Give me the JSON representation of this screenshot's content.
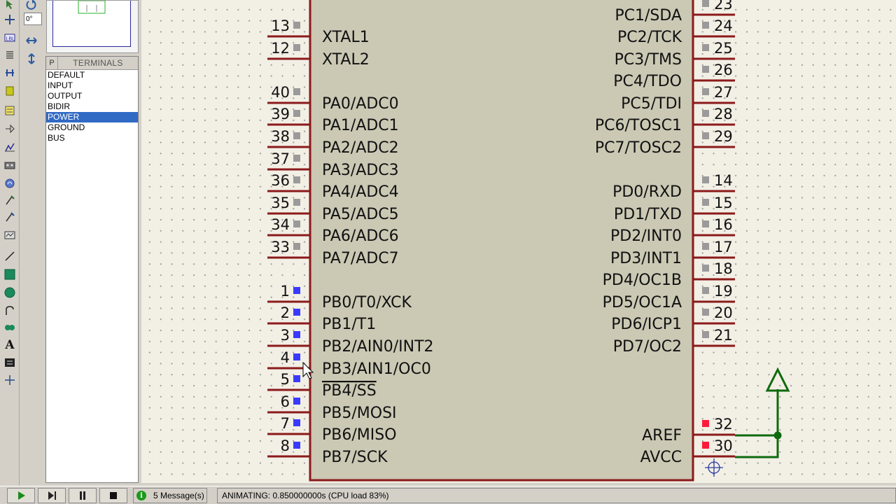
{
  "toolbar": {
    "tools": [
      "undo-icon",
      "component-icon",
      "label-icon",
      "text-script-icon",
      "bus-icon",
      "subcircuit-icon",
      "terminal-icon",
      "pin-icon",
      "graph-icon",
      "tape-icon",
      "generator-icon",
      "probe-icon",
      "current-probe-icon",
      "virtual-instrument-icon",
      "line-icon",
      "box-icon",
      "circle-icon",
      "arc-icon",
      "path-icon",
      "text-icon",
      "symbol-icon",
      "marker-icon"
    ]
  },
  "rotation": {
    "angle_value": "0°"
  },
  "terminals": {
    "p_label": "P",
    "title": "TERMINALS",
    "items": [
      "DEFAULT",
      "INPUT",
      "OUTPUT",
      "BIDIR",
      "POWER",
      "GROUND",
      "BUS"
    ],
    "selected_index": 4
  },
  "schematic": {
    "colors": {
      "body_fill": "#cbc8b4",
      "body_border": "#8b1a1a",
      "pin_line": "#8b1a1a",
      "wire": "#0e6a0e",
      "pin_low": "#3a3aff",
      "pin_high": "#ff1a3c",
      "pin_idle": "#9a9a9a"
    },
    "left_pins": [
      {
        "num": "13",
        "label": "XTAL1",
        "state": "idle"
      },
      {
        "num": "12",
        "label": "XTAL2",
        "state": "idle"
      },
      {
        "num": "40",
        "label": "PA0/ADC0",
        "state": "idle"
      },
      {
        "num": "39",
        "label": "PA1/ADC1",
        "state": "idle"
      },
      {
        "num": "38",
        "label": "PA2/ADC2",
        "state": "idle"
      },
      {
        "num": "37",
        "label": "PA3/ADC3",
        "state": "idle"
      },
      {
        "num": "36",
        "label": "PA4/ADC4",
        "state": "idle"
      },
      {
        "num": "35",
        "label": "PA5/ADC5",
        "state": "idle"
      },
      {
        "num": "34",
        "label": "PA6/ADC6",
        "state": "idle"
      },
      {
        "num": "33",
        "label": "PA7/ADC7",
        "state": "idle"
      },
      {
        "num": "1",
        "label": "PB0/T0/XCK",
        "state": "low"
      },
      {
        "num": "2",
        "label": "PB1/T1",
        "state": "low"
      },
      {
        "num": "3",
        "label": "PB2/AIN0/INT2",
        "state": "low"
      },
      {
        "num": "4",
        "label": "PB3/AIN1/OC0",
        "state": "low"
      },
      {
        "num": "5",
        "label": "PB4/SS",
        "state": "low"
      },
      {
        "num": "6",
        "label": "PB5/MOSI",
        "state": "low"
      },
      {
        "num": "7",
        "label": "PB6/MISO",
        "state": "low"
      },
      {
        "num": "8",
        "label": "PB7/SCK",
        "state": "low"
      }
    ],
    "right_pins": [
      {
        "num": "23",
        "label": "PC1/SDA",
        "state": "idle"
      },
      {
        "num": "24",
        "label": "PC2/TCK",
        "state": "idle"
      },
      {
        "num": "25",
        "label": "PC3/TMS",
        "state": "idle"
      },
      {
        "num": "26",
        "label": "PC4/TDO",
        "state": "idle"
      },
      {
        "num": "27",
        "label": "PC5/TDI",
        "state": "idle"
      },
      {
        "num": "28",
        "label": "PC6/TOSC1",
        "state": "idle"
      },
      {
        "num": "29",
        "label": "PC7/TOSC2",
        "state": "idle"
      },
      {
        "num": "14",
        "label": "PD0/RXD",
        "state": "idle"
      },
      {
        "num": "15",
        "label": "PD1/TXD",
        "state": "idle"
      },
      {
        "num": "16",
        "label": "PD2/INT0",
        "state": "idle"
      },
      {
        "num": "17",
        "label": "PD3/INT1",
        "state": "idle"
      },
      {
        "num": "18",
        "label": "PD4/OC1B",
        "state": "idle"
      },
      {
        "num": "19",
        "label": "PD5/OC1A",
        "state": "idle"
      },
      {
        "num": "20",
        "label": "PD6/ICP1",
        "state": "idle"
      },
      {
        "num": "21",
        "label": "PD7/OC2",
        "state": "idle"
      },
      {
        "num": "32",
        "label": "AREF",
        "state": "high"
      },
      {
        "num": "30",
        "label": "AVCC",
        "state": "high"
      }
    ]
  },
  "status_bar": {
    "messages": "5 Message(s)",
    "info_icon_label": "i",
    "animation_status": "ANIMATING: 0.850000000s (CPU load 83%)"
  }
}
